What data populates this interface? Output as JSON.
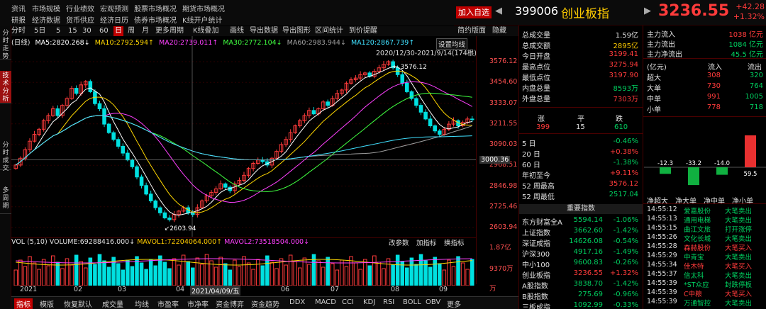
{
  "menu": {
    "row1": [
      "资讯",
      "市场规模",
      "行业绩效",
      "宏观预测",
      "股票市场概况",
      "期货市场概况"
    ],
    "row2": [
      "研报",
      "经济数据",
      "货币供应",
      "经济日历",
      "债券市场概况",
      "K线开户统计"
    ]
  },
  "header": {
    "add_label": "加入自选",
    "prev": "◀",
    "next": "▶",
    "code": "399006",
    "name": "创业板指",
    "price": "3236.55",
    "change": "+42.28",
    "change_pct": "+1.32%"
  },
  "left_tabs": [
    "分时走势",
    "技术分析",
    "分时成交",
    "多周期"
  ],
  "toolbar": {
    "items": [
      "分时",
      "5日",
      "5",
      "15",
      "30",
      "60",
      "日",
      "周",
      "月",
      "更多周期",
      "K线叠加",
      "画线",
      "导出数据",
      "导出图形",
      "区间统计",
      "到价提醒"
    ],
    "right": [
      "简约版面",
      "隐藏"
    ]
  },
  "ma_line": {
    "label": "(日线)",
    "ma5": "MA5:2820.268↓",
    "ma10": "MA10:2792.594↑",
    "ma20": "MA20:2739.011↑",
    "ma30": "MA30:2772.104↓",
    "ma60": "MA60:2983.944↓",
    "ma120": "MA120:2867.739↑"
  },
  "date_range": "2020/12/30-2021/9/14(174根)",
  "set_ma": "设置均线",
  "chart_data": {
    "type": "candlestick",
    "ticks": [
      "3576.12",
      "3454.60",
      "3333.07",
      "3211.55",
      "3090.03",
      "2968.51",
      "2846.98",
      "2725.46",
      "2603.94"
    ],
    "ylim": [
      2603.94,
      3576.12
    ],
    "high_label": "3576.12",
    "low_label": "2603.94",
    "crosshair_value": "3000.36",
    "x_labels": [
      "2021",
      "02",
      "03",
      "04",
      "2021/04/09/五",
      "06",
      "07",
      "08",
      "09"
    ],
    "closes": [
      2970,
      3010,
      3060,
      3110,
      3150,
      3180,
      3230,
      3260,
      3300,
      3260,
      3320,
      3360,
      3420,
      3390,
      3440,
      3460,
      3400,
      3330,
      3300,
      3210,
      3160,
      3120,
      3080,
      3040,
      3000,
      2960,
      2900,
      2850,
      2800,
      2760,
      2720,
      2690,
      2660,
      2650,
      2680,
      2700,
      2720,
      2690,
      2680,
      2720,
      2760,
      2790,
      2810,
      2830,
      2860,
      2840,
      2820,
      2860,
      2880,
      2910,
      2950,
      2980,
      3000,
      2990,
      2970,
      3010,
      3050,
      3090,
      3120,
      3160,
      3200,
      3230,
      3260,
      3290,
      3270,
      3300,
      3340,
      3320,
      3360,
      3390,
      3410,
      3450,
      3470,
      3480,
      3500,
      3510,
      3490,
      3520,
      3540,
      3560,
      3576,
      3540,
      3500,
      3450,
      3400,
      3360,
      3320,
      3280,
      3240,
      3200,
      3170,
      3150,
      3180,
      3210,
      3230,
      3200,
      3220,
      3240,
      3236
    ]
  },
  "volume": {
    "header": "VOL (5,10)",
    "volume": "VOLUME:69288416.000↓",
    "mavol1": "MAVOL1:72204064.000↑",
    "mavol2": "MAVOL2:73518504.000↓",
    "buttons": [
      "改参数",
      "加指标",
      "换指标"
    ],
    "ticks": [
      "1.87亿",
      "9370万",
      "万"
    ]
  },
  "bottom_tabs": [
    "指标",
    "模版",
    "恢复默认",
    "成交量",
    "均线",
    "市盈率",
    "市净率",
    "资金博弈",
    "资金趋势",
    "DDX",
    "MACD",
    "CCI",
    "KDJ",
    "RSI",
    "BOLL",
    "OBV",
    "更多"
  ],
  "stats": [
    {
      "label": "总成交量",
      "value": "1.59亿",
      "cls": "white"
    },
    {
      "label": "总成交额",
      "value": "2895亿",
      "cls": "yellow"
    },
    {
      "label": "今日开盘",
      "value": "3199.41",
      "cls": "red"
    },
    {
      "label": "最高点位",
      "value": "3275.94",
      "cls": "red"
    },
    {
      "label": "最低点位",
      "value": "3197.90",
      "cls": "red"
    },
    {
      "label": "内盘总量",
      "value": "8593万",
      "cls": "green"
    },
    {
      "label": "外盘总量",
      "value": "7303万",
      "cls": "red"
    }
  ],
  "breadth": {
    "labels": [
      "涨",
      "平",
      "跌"
    ],
    "values": [
      "399",
      "15",
      "610"
    ]
  },
  "periods": [
    {
      "label": "5 日",
      "value": "-0.46%",
      "cls": "green"
    },
    {
      "label": "20 日",
      "value": "+0.38%",
      "cls": "red"
    },
    {
      "label": "60 日",
      "value": "-1.38%",
      "cls": "green"
    },
    {
      "label": "年初至今",
      "value": "+9.11%",
      "cls": "red"
    },
    {
      "label": "52 周最高",
      "value": "3576.12",
      "cls": "red"
    },
    {
      "label": "52 周最低",
      "value": "2517.04",
      "cls": "green"
    }
  ],
  "indices_title": "重要指数",
  "indices": [
    {
      "name": "东方财富全A",
      "price": "5594.14",
      "pct": "-1.06%",
      "cls": "green"
    },
    {
      "name": "上证指数",
      "price": "3662.60",
      "pct": "-1.42%",
      "cls": "green"
    },
    {
      "name": "深证成指",
      "price": "14626.08",
      "pct": "-0.54%",
      "cls": "green"
    },
    {
      "name": "沪深300",
      "price": "4917.16",
      "pct": "-1.49%",
      "cls": "green"
    },
    {
      "name": "中小100",
      "price": "9600.83",
      "pct": "-0.26%",
      "cls": "green"
    },
    {
      "name": "创业板指",
      "price": "3236.55",
      "pct": "+1.32%",
      "cls": "red"
    },
    {
      "name": "A股指数",
      "price": "3838.70",
      "pct": "-1.42%",
      "cls": "green"
    },
    {
      "name": "B股指数",
      "price": "275.69",
      "pct": "-0.96%",
      "cls": "green"
    },
    {
      "name": "三板成指",
      "price": "1092.99",
      "pct": "-0.33%",
      "cls": "green"
    }
  ],
  "fund_flow": [
    {
      "label": "主力流入",
      "value": "1038 亿元"
    },
    {
      "label": "主力流出",
      "value": "1084 亿元"
    },
    {
      "label": "主力净流出",
      "value": "45.5 亿元"
    }
  ],
  "flow_table": {
    "unit": "(亿元)",
    "head_in": "流入",
    "head_out": "流出",
    "rows": [
      {
        "label": "超大",
        "in": "308",
        "out": "320"
      },
      {
        "label": "大单",
        "in": "730",
        "out": "764"
      },
      {
        "label": "中单",
        "in": "991",
        "out": "1005"
      },
      {
        "label": "小单",
        "in": "778",
        "out": "718"
      }
    ]
  },
  "net_bars": {
    "labels": [
      "净超大",
      "净大单",
      "净中单",
      "净小单"
    ],
    "values": [
      -12.3,
      -33.2,
      -14.0,
      59.5
    ],
    "value_labels": [
      "-12.3",
      "-33.2",
      "-14.0",
      "59.5"
    ]
  },
  "trades": [
    {
      "time": "14:55:12",
      "name": "爱嘉股份",
      "action": "大笔卖出",
      "cls": "green"
    },
    {
      "time": "14:55:13",
      "name": "通用电梯",
      "action": "大笔卖出",
      "cls": "green"
    },
    {
      "time": "14:55:15",
      "name": "曲江文旅",
      "action": "打开涨停",
      "cls": "green"
    },
    {
      "time": "14:55:26",
      "name": "文化长城",
      "action": "大笔卖出",
      "cls": "green"
    },
    {
      "time": "14:55:28",
      "name": "森赫股份",
      "action": "大笔买入",
      "cls": "red"
    },
    {
      "time": "14:55:29",
      "name": "中青宝",
      "action": "大笔卖出",
      "cls": "green"
    },
    {
      "time": "14:55:34",
      "name": "佳木特",
      "action": "大笔买入",
      "cls": "red"
    },
    {
      "time": "14:55:37",
      "name": "信太科",
      "action": "大笔卖出",
      "cls": "green"
    },
    {
      "time": "14:55:39",
      "name": "*ST众应",
      "action": "封跌停板",
      "cls": "green"
    },
    {
      "time": "14:55:39",
      "name": "C中粮",
      "action": "大笔买入",
      "cls": "red"
    },
    {
      "time": "14:55:39",
      "name": "万通智控",
      "action": "大笔卖出",
      "cls": "green"
    }
  ]
}
